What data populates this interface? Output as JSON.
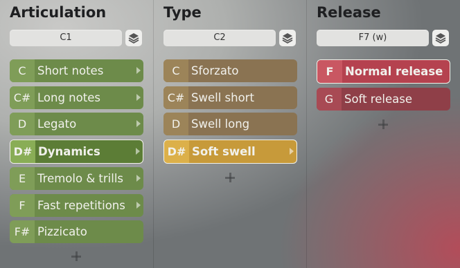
{
  "columns": [
    {
      "title": "Articulation",
      "selector": "C1",
      "items": [
        {
          "key": "C",
          "label": "Short notes",
          "arrow": true,
          "selected": false
        },
        {
          "key": "C#",
          "label": "Long notes",
          "arrow": true,
          "selected": false
        },
        {
          "key": "D",
          "label": "Legato",
          "arrow": true,
          "selected": false
        },
        {
          "key": "D#",
          "label": "Dynamics",
          "arrow": true,
          "selected": true
        },
        {
          "key": "E",
          "label": "Tremolo & trills",
          "arrow": true,
          "selected": false
        },
        {
          "key": "F",
          "label": "Fast repetitions",
          "arrow": true,
          "selected": false
        },
        {
          "key": "F#",
          "label": "Pizzicato",
          "arrow": false,
          "selected": false
        }
      ]
    },
    {
      "title": "Type",
      "selector": "C2",
      "items": [
        {
          "key": "C",
          "label": "Sforzato",
          "arrow": false,
          "selected": false
        },
        {
          "key": "C#",
          "label": "Swell short",
          "arrow": false,
          "selected": false
        },
        {
          "key": "D",
          "label": "Swell long",
          "arrow": false,
          "selected": false
        },
        {
          "key": "D#",
          "label": "Soft swell",
          "arrow": true,
          "selected": true
        }
      ]
    },
    {
      "title": "Release",
      "selector": "F7 (w)",
      "items": [
        {
          "key": "F",
          "label": "Normal release",
          "arrow": false,
          "selected": true
        },
        {
          "key": "G",
          "label": "Soft release",
          "arrow": false,
          "selected": false
        }
      ]
    }
  ],
  "icons": {
    "layers": "layers-icon",
    "add": "plus-icon",
    "submenu": "arrow-right-icon"
  },
  "colors": {
    "articulation": "#6d8b4a",
    "type": "#8a7352",
    "release": "#8f3f48"
  }
}
